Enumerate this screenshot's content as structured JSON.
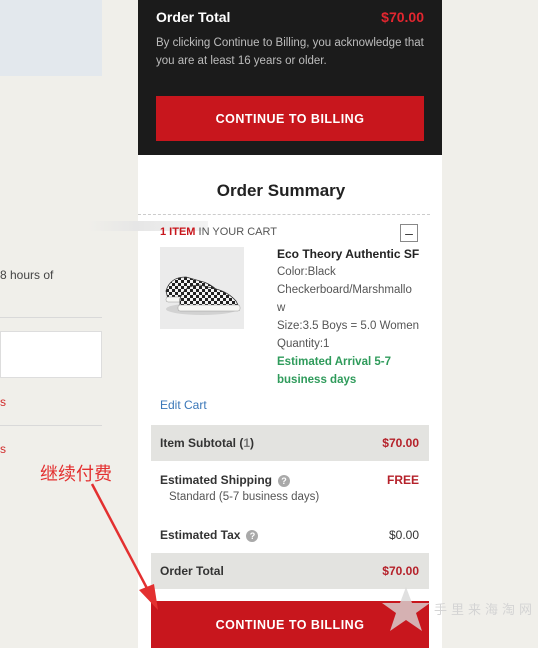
{
  "left_fragments": {
    "hours_text": "8 hours of",
    "red_marks": [
      "s",
      "s"
    ]
  },
  "order_total_block": {
    "label": "Order Total",
    "price": "$70.00",
    "note": "By clicking Continue to Billing, you acknowledge that you are at least 16 years or older.",
    "button_label": "CONTINUE TO BILLING"
  },
  "summary": {
    "title": "Order Summary",
    "item_count": "1 ITEM",
    "in_your_cart": "IN YOUR CART",
    "toggle": "–",
    "product": {
      "name": "Eco Theory Authentic SF",
      "color_line1": "Color:Black",
      "color_line2": "Checkerboard/Marshmallo",
      "color_line3": "w",
      "size": "Size:3.5 Boys = 5.0 Women",
      "quantity": "Quantity:1",
      "arrival_line1": "Estimated Arrival 5-7",
      "arrival_line2": "business days"
    },
    "edit_cart": "Edit Cart",
    "subtotal": {
      "label": "Item Subtotal (",
      "count": "1",
      "close": ")",
      "value": "$70.00"
    },
    "shipping": {
      "label": "Estimated Shipping",
      "value": "FREE",
      "method": "Standard (5-7 business days)"
    },
    "tax": {
      "label": "Estimated Tax",
      "value": "$0.00"
    },
    "order_total": {
      "label": "Order Total",
      "value": "$70.00"
    },
    "button_label": "CONTINUE TO BILLING"
  },
  "annotation": {
    "text": "继续付费"
  },
  "watermark": {
    "text": "手里来海淘网"
  },
  "colors": {
    "accent_red": "#c8161d",
    "dark_panel": "#1b1b1b",
    "arrival_green": "#2f9b5b",
    "link_blue": "#3a77b8"
  }
}
